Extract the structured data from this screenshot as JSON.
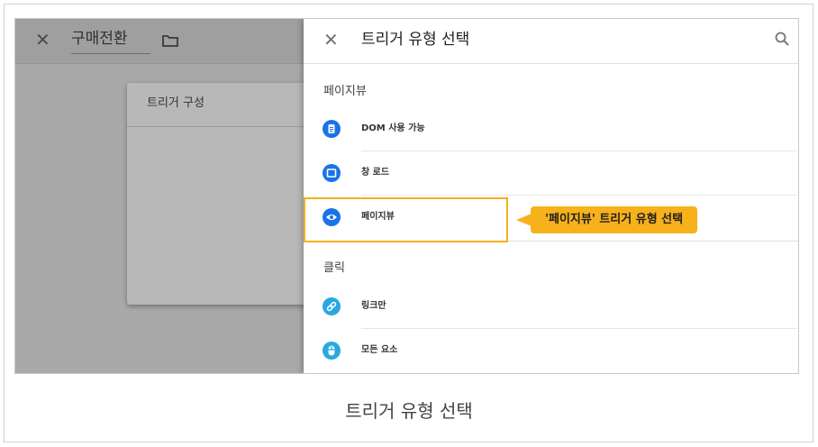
{
  "editor": {
    "close_glyph": "✕",
    "name": "구매전환",
    "card_title": "트리거 구성"
  },
  "panel": {
    "close_glyph": "✕",
    "title": "트리거 유형 선택",
    "sections": [
      {
        "label": "페이지뷰",
        "items": [
          {
            "label": "DOM 사용 가능",
            "icon": "document-icon",
            "color": "#1a73e8"
          },
          {
            "label": "창 로드",
            "icon": "window-icon",
            "color": "#1a73e8"
          },
          {
            "label": "페이지뷰",
            "icon": "eye-icon",
            "color": "#1a73e8"
          }
        ]
      },
      {
        "label": "클릭",
        "items": [
          {
            "label": "링크만",
            "icon": "link-icon",
            "color": "#29a8e0"
          },
          {
            "label": "모든 요소",
            "icon": "mouse-icon",
            "color": "#29a8e0"
          }
        ]
      }
    ]
  },
  "annotation": {
    "callout": "'페이지뷰' 트리거 유형 선택",
    "color": "#f7b11a"
  },
  "caption": "트리거 유형 선택"
}
